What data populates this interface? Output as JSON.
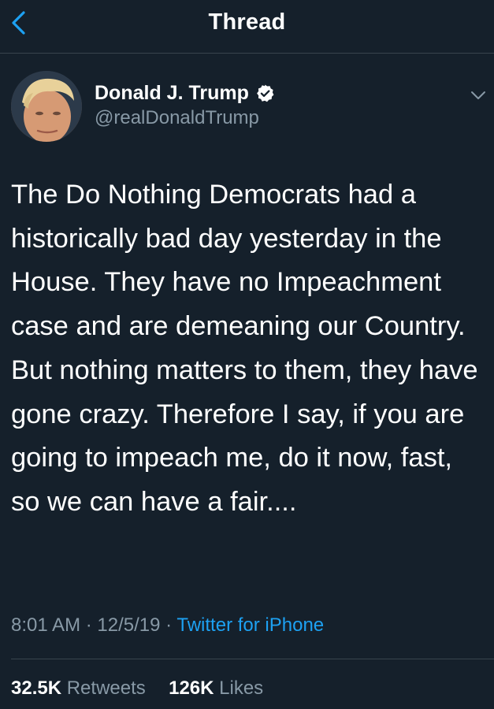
{
  "nav": {
    "title": "Thread",
    "back_icon": "chevron-left-icon"
  },
  "tweet": {
    "author": {
      "name": "Donald J. Trump",
      "handle": "@realDonaldTrump",
      "verified_icon": "verified-badge-icon"
    },
    "more_icon": "chevron-down-icon",
    "text": "The Do Nothing Democrats had a historically bad day yesterday in the House. They have no Impeachment case and are demeaning our Country. But nothing matters to them, they have gone crazy. Therefore I say, if you are going to impeach me, do it now, fast, so we can have a fair....",
    "time": "8:01 AM",
    "separator": "·",
    "date": "12/5/19",
    "source": "Twitter for iPhone",
    "stats": {
      "retweets_count": "32.5K",
      "retweets_label": "Retweets",
      "likes_count": "126K",
      "likes_label": "Likes"
    }
  },
  "colors": {
    "background": "#15202b",
    "accent": "#1da1f2",
    "muted_text": "#8899a6",
    "divider": "#38444d"
  }
}
